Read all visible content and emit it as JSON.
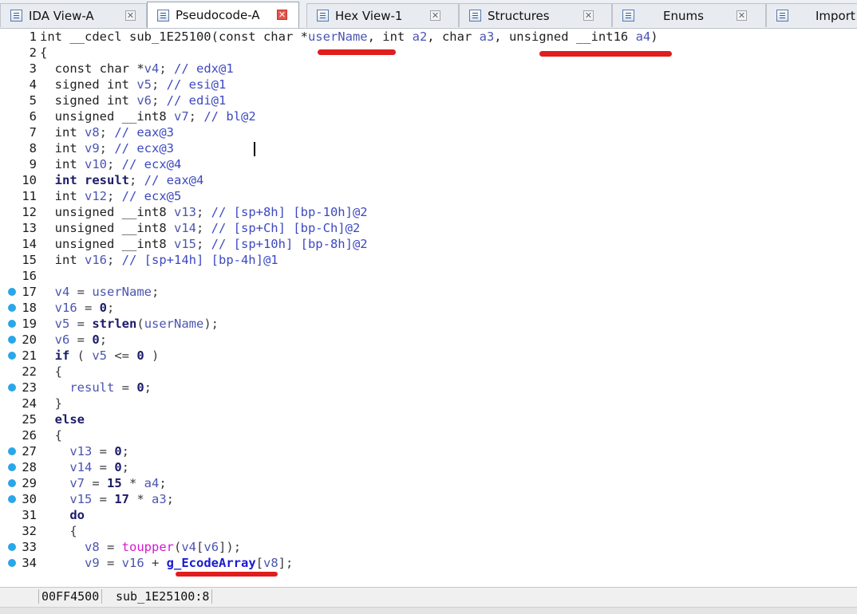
{
  "tabs": [
    {
      "label": "IDA View-A",
      "icon": "document-icon",
      "active": false
    },
    {
      "label": "Pseudocode-A",
      "icon": "document-icon",
      "active": true
    },
    {
      "label": "Hex View-1",
      "icon": "hex-icon",
      "active": false
    },
    {
      "label": "Structures",
      "icon": "structure-icon",
      "active": false
    },
    {
      "label": "Enums",
      "icon": "enum-icon",
      "active": false
    },
    {
      "label": "Import",
      "icon": "import-icon",
      "active": false
    }
  ],
  "close_glyph": "✕",
  "code_lines": [
    {
      "n": "1",
      "dot": false,
      "html": "<span class='tp'>int __cdecl sub_1E25100(const char *</span><span class='vr'>userName</span><span class='tp'>, int </span><span class='vr'>a2</span><span class='tp'>, char </span><span class='vr'>a3</span><span class='tp'>, unsigned __int16 </span><span class='vr'>a4</span><span class='tp'>)</span>"
    },
    {
      "n": "2",
      "dot": false,
      "html": "<span class='tp'>{</span>"
    },
    {
      "n": "3",
      "dot": false,
      "html": "  <span class='tp'>const char *</span><span class='vr'>v4</span>; <span class='cm'>// edx@1</span>"
    },
    {
      "n": "4",
      "dot": false,
      "html": "  <span class='tp'>signed int </span><span class='vr'>v5</span>; <span class='cm'>// esi@1</span>"
    },
    {
      "n": "5",
      "dot": false,
      "html": "  <span class='tp'>signed int </span><span class='vr'>v6</span>; <span class='cm'>// edi@1</span>"
    },
    {
      "n": "6",
      "dot": false,
      "html": "  <span class='tp'>unsigned __int8 </span><span class='vr'>v7</span>; <span class='cm'>// bl@2</span>"
    },
    {
      "n": "7",
      "dot": false,
      "html": "  <span class='tp'>int </span><span class='vr'>v8</span>; <span class='cm'>// eax@3</span>"
    },
    {
      "n": "8",
      "dot": false,
      "html": "  <span class='tp'>int </span><span class='vr'>v9</span>; <span class='cm'>// ecx@3</span>"
    },
    {
      "n": "9",
      "dot": false,
      "html": "  <span class='tp'>int </span><span class='vr'>v10</span>; <span class='cm'>// ecx@4</span>"
    },
    {
      "n": "10",
      "dot": false,
      "html": "  <span class='kw'>int result</span>; <span class='cm'>// eax@4</span>"
    },
    {
      "n": "11",
      "dot": false,
      "html": "  <span class='tp'>int </span><span class='vr'>v12</span>; <span class='cm'>// ecx@5</span>"
    },
    {
      "n": "12",
      "dot": false,
      "html": "  <span class='tp'>unsigned __int8 </span><span class='vr'>v13</span>; <span class='cm'>// [sp+8h] [bp-10h]@2</span>"
    },
    {
      "n": "13",
      "dot": false,
      "html": "  <span class='tp'>unsigned __int8 </span><span class='vr'>v14</span>; <span class='cm'>// [sp+Ch] [bp-Ch]@2</span>"
    },
    {
      "n": "14",
      "dot": false,
      "html": "  <span class='tp'>unsigned __int8 </span><span class='vr'>v15</span>; <span class='cm'>// [sp+10h] [bp-8h]@2</span>"
    },
    {
      "n": "15",
      "dot": false,
      "html": "  <span class='tp'>int </span><span class='vr'>v16</span>; <span class='cm'>// [sp+14h] [bp-4h]@1</span>"
    },
    {
      "n": "16",
      "dot": false,
      "html": ""
    },
    {
      "n": "17",
      "dot": true,
      "html": "  <span class='vr'>v4</span> = <span class='vr'>userName</span>;"
    },
    {
      "n": "18",
      "dot": true,
      "html": "  <span class='vr'>v16</span> = <span class='kw'>0</span>;"
    },
    {
      "n": "19",
      "dot": true,
      "html": "  <span class='vr'>v5</span> = <span class='kw'>strlen</span>(<span class='vr'>userName</span>);"
    },
    {
      "n": "20",
      "dot": true,
      "html": "  <span class='vr'>v6</span> = <span class='kw'>0</span>;"
    },
    {
      "n": "21",
      "dot": true,
      "html": "  <span class='kw'>if</span> ( <span class='vr'>v5</span> &lt;= <span class='kw'>0</span> )"
    },
    {
      "n": "22",
      "dot": false,
      "html": "  {"
    },
    {
      "n": "23",
      "dot": true,
      "html": "    <span class='vr'>result</span> = <span class='kw'>0</span>;"
    },
    {
      "n": "24",
      "dot": false,
      "html": "  }"
    },
    {
      "n": "25",
      "dot": false,
      "html": "  <span class='kw'>else</span>"
    },
    {
      "n": "26",
      "dot": false,
      "html": "  {"
    },
    {
      "n": "27",
      "dot": true,
      "html": "    <span class='vr'>v13</span> = <span class='kw'>0</span>;"
    },
    {
      "n": "28",
      "dot": true,
      "html": "    <span class='vr'>v14</span> = <span class='kw'>0</span>;"
    },
    {
      "n": "29",
      "dot": true,
      "html": "    <span class='vr'>v7</span> = <span class='kw'>15</span> * <span class='vr'>a4</span>;"
    },
    {
      "n": "30",
      "dot": true,
      "html": "    <span class='vr'>v15</span> = <span class='kw'>17</span> * <span class='vr'>a3</span>;"
    },
    {
      "n": "31",
      "dot": false,
      "html": "    <span class='kw'>do</span>"
    },
    {
      "n": "32",
      "dot": false,
      "html": "    {"
    },
    {
      "n": "33",
      "dot": true,
      "html": "      <span class='vr'>v8</span> = <span class='fn'>toupper</span>(<span class='vr'>v4</span>[<span class='vr'>v6</span>]);"
    },
    {
      "n": "34",
      "dot": true,
      "html": "      <span class='vr'>v9</span> = <span class='vr'>v16</span> + <span class='gl'>g_EcodeArray</span>[<span class='vr'>v8</span>];"
    }
  ],
  "status": {
    "address": "00FF4500",
    "location": "sub_1E25100:8"
  },
  "colors": {
    "accent_red": "#e11d1d",
    "breakpoint_dot": "#2aa7e8"
  }
}
